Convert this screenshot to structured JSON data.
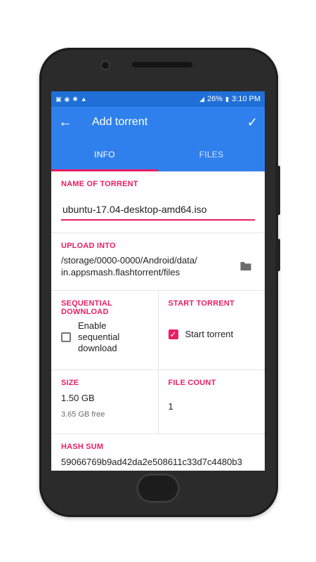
{
  "statusbar": {
    "icons_left": [
      "notification-icon",
      "whatsapp-icon",
      "settings-icon",
      "warning-icon"
    ],
    "battery_percent": "26%",
    "time": "3:10 PM"
  },
  "toolbar": {
    "title": "Add torrent",
    "back_icon": "arrow-back-icon",
    "confirm_icon": "check-icon"
  },
  "tabs": [
    {
      "label": "INFO",
      "active": true
    },
    {
      "label": "FILES",
      "active": false
    }
  ],
  "name_section": {
    "label": "NAME OF TORRENT",
    "value": "ubuntu-17.04-desktop-amd64.iso"
  },
  "upload_section": {
    "label": "UPLOAD INTO",
    "path_line1": "/storage/0000-0000/Android/data/",
    "path_line2": "in.appsmash.flashtorrent/files"
  },
  "sequential": {
    "label_line1": "SEQUENTIAL",
    "label_line2": "DOWNLOAD",
    "option_line1": "Enable",
    "option_line2": "sequential",
    "option_line3": "download",
    "checked": false
  },
  "start_torrent": {
    "label": "START TORRENT",
    "option": "Start torrent",
    "checked": true
  },
  "size": {
    "label": "SIZE",
    "value": "1.50 GB",
    "free": "3.65 GB free"
  },
  "file_count": {
    "label": "FILE COUNT",
    "value": "1"
  },
  "hash_sum": {
    "label": "HASH SUM",
    "value": "59066769b9ad42da2e508611c33d7c4480b3"
  },
  "colors": {
    "primary": "#2f80ed",
    "status_bar": "#1f6fd6",
    "accent": "#e91e63"
  }
}
